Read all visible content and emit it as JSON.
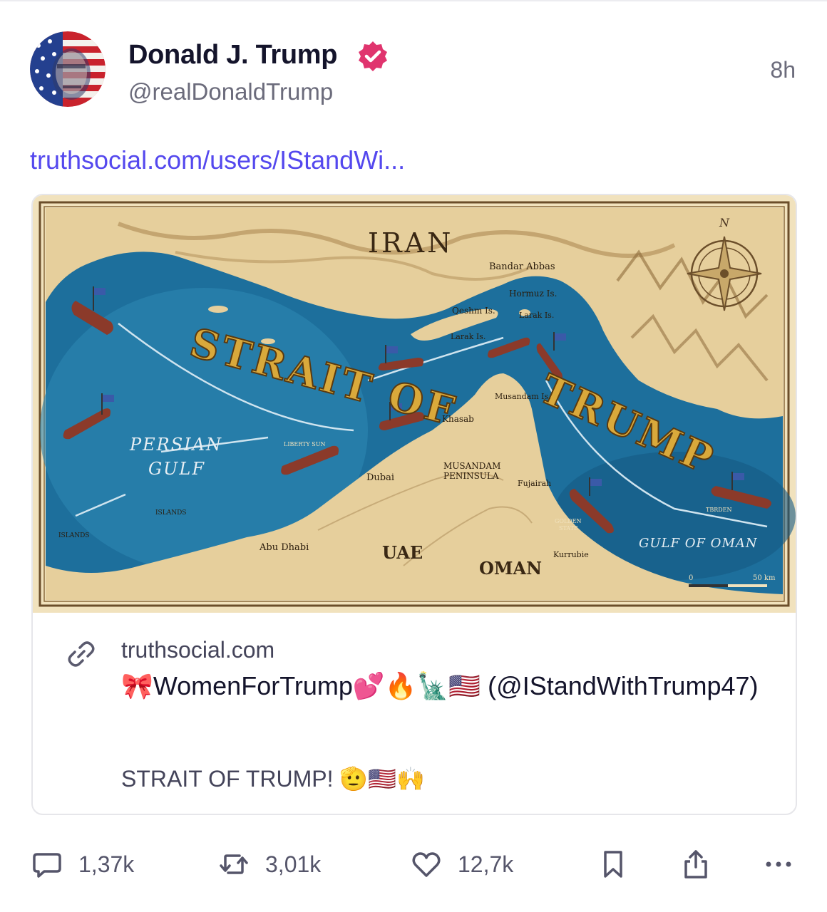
{
  "post": {
    "author_name": "Donald J. Trump",
    "author_handle": "@realDonaldTrump",
    "time_ago": "8h",
    "link_text": "truthsocial.com/users/IStandWi..."
  },
  "card": {
    "domain": "truthsocial.com",
    "title": "🎀WomenForTrump💕🔥🗽🇺🇸 (@IStandWithTrump47)",
    "description": "STRAIT OF TRUMP! 🫡🇺🇸🙌",
    "map": {
      "title_line1": "STRAIT OF",
      "title_line2": "TRUMP",
      "labels": {
        "iran": "IRAN",
        "uae": "UAE",
        "oman": "OMAN",
        "persian_gulf_1": "PERSIAN",
        "persian_gulf_2": "GULF",
        "gulf_of_oman": "GULF OF OMAN",
        "bandar_abbas": "Bandar Abbas",
        "hormuz": "Hormuz Is.",
        "qeshm": "Qeshm Is.",
        "larak_1": "Larak Is.",
        "larak_2": "Larak Is.",
        "musandam_is": "Musandam Is.",
        "khasab": "Khasab",
        "musandam_pen_1": "MUSANDAM",
        "musandam_pen_2": "PENINSULA",
        "dubai": "Dubai",
        "abu_dhabi": "Abu Dhabi",
        "fujairah": "Fujairah",
        "kurrubie": "Kurrubie",
        "golden_1": "GOLDEN",
        "golden_2": "STATE",
        "liberty_sun": "LIBERTY SUN",
        "islands_1": "ISLANDS",
        "islands_2": "ISLANDS",
        "tbrden": "TBRDEN",
        "compass_n": "N",
        "scale_0": "0",
        "scale_50": "50 km"
      }
    }
  },
  "actions": {
    "replies": "1,37k",
    "reposts": "3,01k",
    "likes": "12,7k"
  },
  "colors": {
    "link": "#5448ee",
    "verified": "#e0346e",
    "sea": "#1d6f9c",
    "land": "#e6cf9c",
    "title_gold": "#d9a93b"
  }
}
